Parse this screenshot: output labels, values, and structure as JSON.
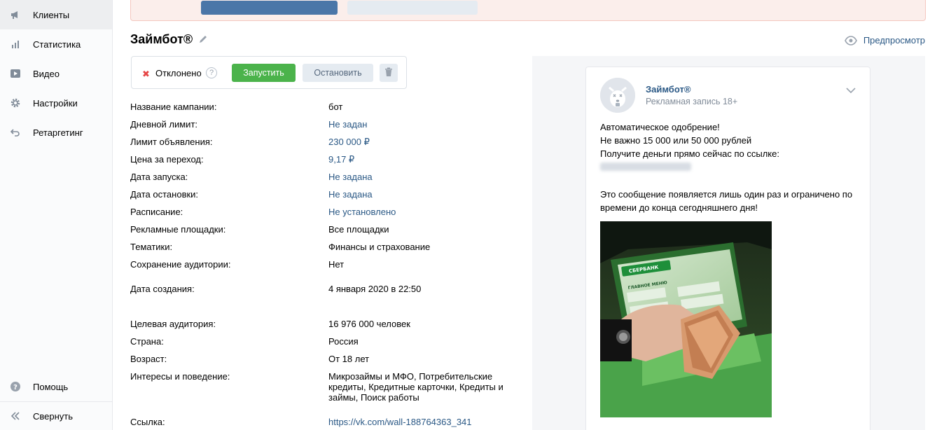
{
  "sidebar": {
    "items": [
      {
        "label": "Клиенты",
        "icon": "megaphone-icon",
        "active": true
      },
      {
        "label": "Статистика",
        "icon": "bar-chart-icon"
      },
      {
        "label": "Видео",
        "icon": "video-icon"
      },
      {
        "label": "Настройки",
        "icon": "gear-icon"
      },
      {
        "label": "Ретаргетинг",
        "icon": "retarget-icon"
      }
    ],
    "help_label": "Помощь",
    "collapse_label": "Свернуть"
  },
  "header": {
    "title": "Займбот®",
    "preview_label": "Предпросмотр"
  },
  "status": {
    "text": "Отклонено",
    "help": "?",
    "start_label": "Запустить",
    "stop_label": "Остановить"
  },
  "info": [
    {
      "label": "Название кампании:",
      "value": "бот",
      "link": false
    },
    {
      "label": "Дневной лимит:",
      "value": "Не задан",
      "link": true
    },
    {
      "label": "Лимит объявления:",
      "value": "230 000 ₽",
      "link": true
    },
    {
      "label": "Цена за переход:",
      "value": "9,17 ₽",
      "link": true
    },
    {
      "label": "Дата запуска:",
      "value": "Не задана",
      "link": true
    },
    {
      "label": "Дата остановки:",
      "value": "Не задана",
      "link": true
    },
    {
      "label": "Расписание:",
      "value": "Не установлено",
      "link": true
    },
    {
      "label": "Рекламные площадки:",
      "value": "Все площадки",
      "link": false
    },
    {
      "label": "Тематики:",
      "value": "Финансы и страхование",
      "link": false
    },
    {
      "label": "Сохранение аудитории:",
      "value": "Нет",
      "link": false
    },
    {
      "label": "Дата создания:",
      "value": "4 января 2020 в 22:50",
      "link": false
    },
    {
      "label": "Целевая аудитория:",
      "value": "16 976 000 человек",
      "link": false
    },
    {
      "label": "Страна:",
      "value": "Россия",
      "link": false
    },
    {
      "label": "Возраст:",
      "value": "От 18 лет",
      "link": false
    },
    {
      "label": "Интересы и поведение:",
      "value": "Микрозаймы и МФО, Потребительские кредиты, Кредитные карточки, Кредиты и займы, Поиск работы",
      "link": false
    },
    {
      "label": "Ссылка:",
      "value": "https://vk.com/wall-188764363_341",
      "link": true
    }
  ],
  "post": {
    "author": "Займбот®",
    "subtitle": "Рекламная запись 18+",
    "lines": [
      "Автоматическое одобрение!",
      "Не важно 15 000 или 50 000 рублей",
      "Получите деньги прямо сейчас по ссылке:",
      "Это сообщение появляется лишь один раз и ограничено по",
      "времени до конца сегодняшнего дня!"
    ],
    "atm_brand": "СБЕРБАНК",
    "atm_menu": "ГЛАВНОЕ МЕНЮ"
  },
  "colors": {
    "link": "#2a5885",
    "start_button": "#4bb34b",
    "rejected": "#e64646",
    "alert_bg": "#fbeeeb"
  }
}
